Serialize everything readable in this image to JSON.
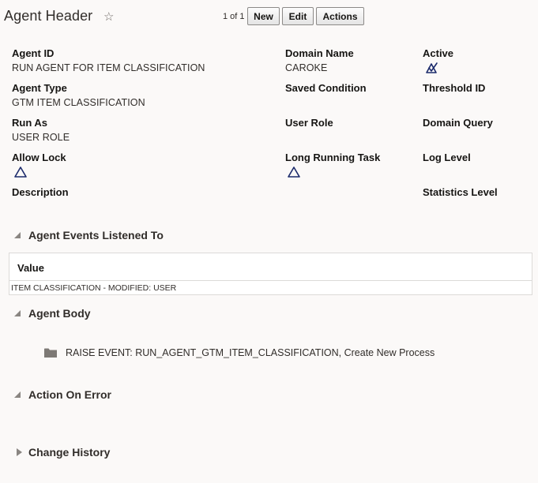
{
  "header": {
    "title": "Agent Header",
    "pager": "1 of 1",
    "buttons": {
      "new": "New",
      "edit": "Edit",
      "actions": "Actions"
    }
  },
  "fields": {
    "agent_id": {
      "label": "Agent ID",
      "value": "RUN AGENT FOR ITEM CLASSIFICATION"
    },
    "domain_name": {
      "label": "Domain Name",
      "value": "CAROKE"
    },
    "active": {
      "label": "Active",
      "state": "checked-triangle-icon"
    },
    "agent_type": {
      "label": "Agent Type",
      "value": "GTM ITEM CLASSIFICATION"
    },
    "saved_condition": {
      "label": "Saved Condition"
    },
    "threshold_id": {
      "label": "Threshold ID"
    },
    "run_as": {
      "label": "Run As",
      "value": "USER ROLE"
    },
    "user_role": {
      "label": "User Role"
    },
    "domain_query": {
      "label": "Domain Query"
    },
    "allow_lock": {
      "label": "Allow Lock",
      "state": "unchecked-triangle-icon"
    },
    "long_running_task": {
      "label": "Long Running Task",
      "state": "unchecked-triangle-icon"
    },
    "log_level": {
      "label": "Log Level"
    },
    "description": {
      "label": "Description"
    },
    "statistics_level": {
      "label": "Statistics Level"
    }
  },
  "sections": {
    "agent_events": {
      "title": "Agent Events Listened To",
      "columns": [
        "Value"
      ],
      "rows": [
        [
          "ITEM CLASSIFICATION - MODIFIED: USER"
        ]
      ]
    },
    "agent_body": {
      "title": "Agent Body",
      "items": [
        "RAISE EVENT: RUN_AGENT_GTM_ITEM_CLASSIFICATION, Create New Process"
      ]
    },
    "action_on_error": {
      "title": "Action On Error"
    },
    "change_history": {
      "title": "Change History"
    }
  },
  "colors": {
    "icon_navy": "#1b2a6b",
    "section_chevron": "#8a8682"
  }
}
